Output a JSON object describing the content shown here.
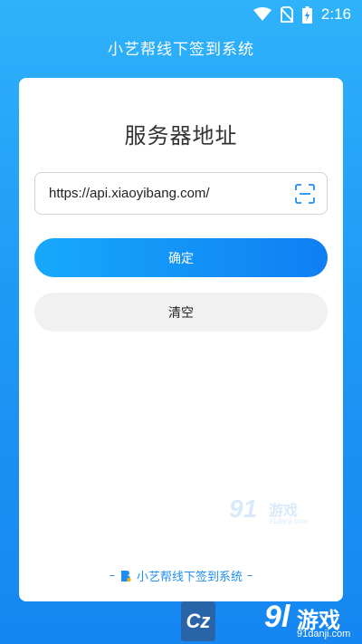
{
  "status_bar": {
    "time": "2:16",
    "icons": [
      "wifi-icon",
      "no-sim-icon",
      "battery-charging-icon"
    ]
  },
  "app": {
    "title": "小艺帮线下签到系统"
  },
  "card": {
    "title": "服务器地址",
    "url_field": {
      "value": "https://api.xiaoyibang.com/",
      "scan_icon": "scan-icon"
    },
    "confirm_label": "确定",
    "clear_label": "清空"
  },
  "footer": {
    "brand": "小艺帮线下签到系统",
    "dash_left": "–",
    "dash_right": "–"
  },
  "watermark": {
    "small_num": "91",
    "small_cn": "游戏",
    "small_url": "91danji.com",
    "badge": "Cz",
    "big_num": "9l",
    "big_cn": "游戏",
    "big_url": "91danji.com"
  },
  "colors": {
    "primary": "#1586f2",
    "accent": "#17a9fb",
    "clear_bg": "#f1f1f1"
  }
}
